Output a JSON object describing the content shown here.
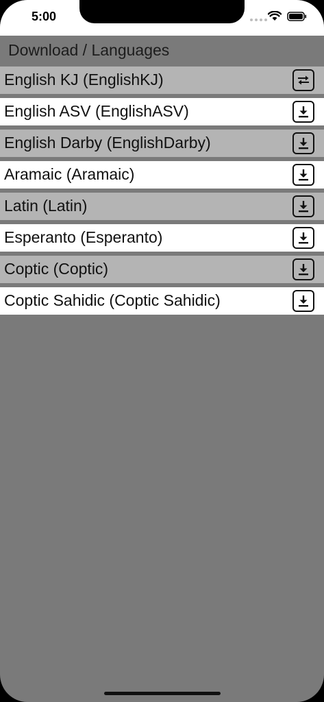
{
  "status_bar": {
    "time": "5:00"
  },
  "header": {
    "title": "Download / Languages"
  },
  "languages": [
    {
      "label": "English KJ (EnglishKJ)",
      "action_icon": "swap-arrows-icon"
    },
    {
      "label": "English ASV (EnglishASV)",
      "action_icon": "download-icon"
    },
    {
      "label": "English Darby (EnglishDarby)",
      "action_icon": "download-icon"
    },
    {
      "label": "Aramaic (Aramaic)",
      "action_icon": "download-icon"
    },
    {
      "label": "Latin (Latin)",
      "action_icon": "download-icon"
    },
    {
      "label": "Esperanto (Esperanto)",
      "action_icon": "download-icon"
    },
    {
      "label": "Coptic (Coptic)",
      "action_icon": "download-icon"
    },
    {
      "label": "Coptic Sahidic (Coptic Sahidic)",
      "action_icon": "download-icon"
    }
  ],
  "colors": {
    "background": "#7a7a7a",
    "row_gray": "#b4b4b4",
    "row_white": "#ffffff"
  }
}
